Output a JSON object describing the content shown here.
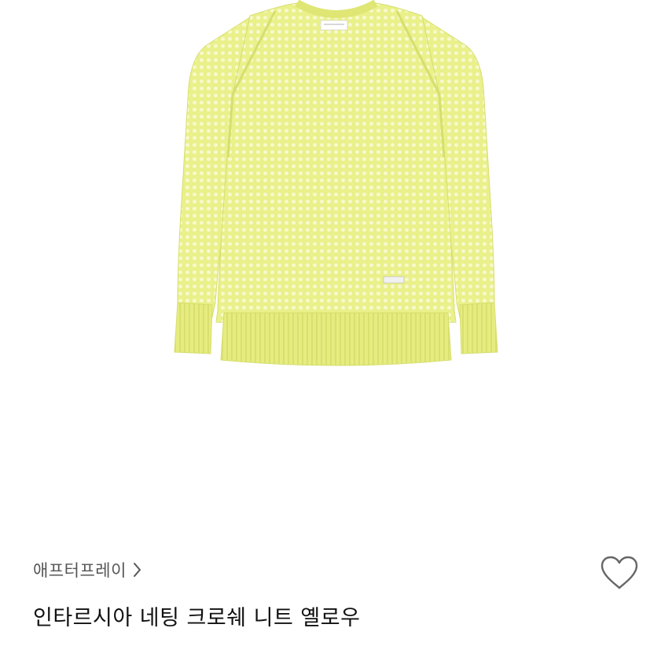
{
  "product": {
    "brand": "애프터프레이",
    "title": "인타르시아 네팅 크로쉐 니트 옐로우",
    "image": "yellow-mesh-crochet-knit-sweater"
  },
  "icons": {
    "brand_link": "chevron-right-icon",
    "wishlist": "heart-outline-icon"
  },
  "colors": {
    "sweater": "#eaf08a",
    "sweater_shadow": "#d6de6e",
    "text_brand": "#555555",
    "text_title": "#111111",
    "heart_stroke": "#666666"
  }
}
